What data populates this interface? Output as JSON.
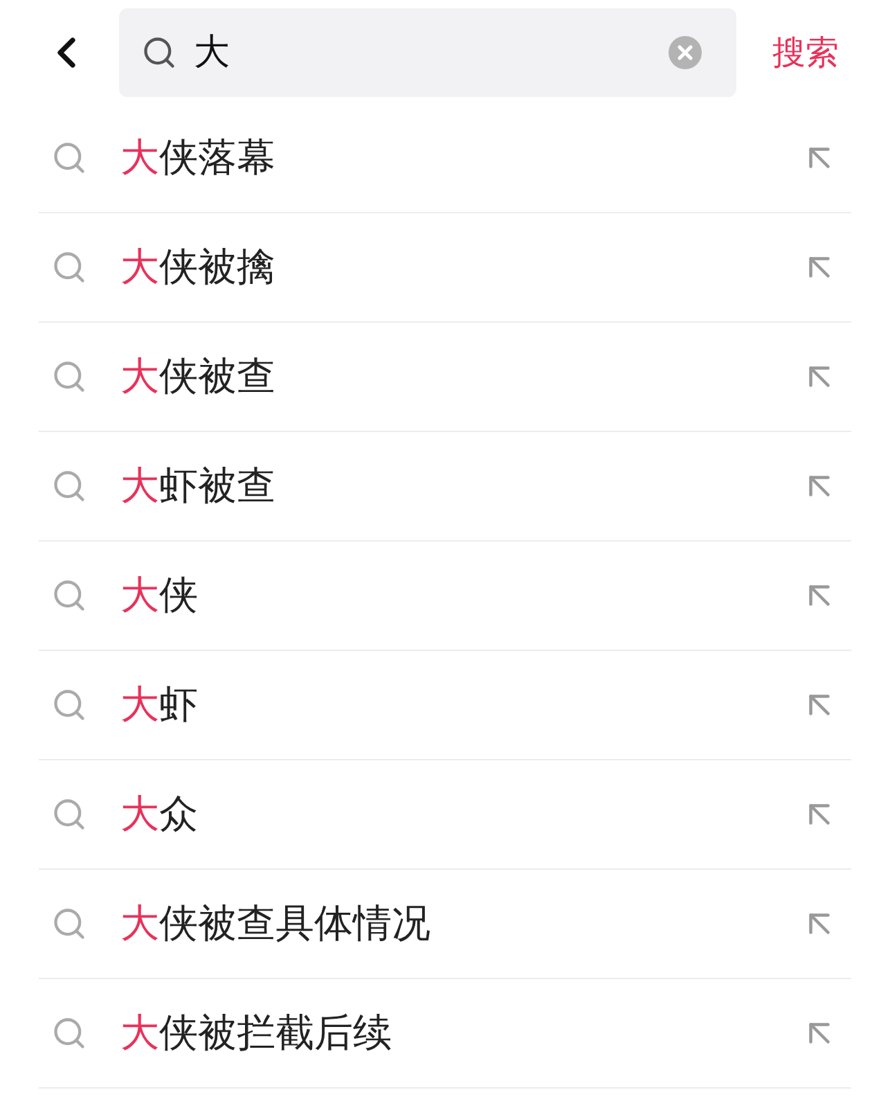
{
  "search": {
    "value": "大",
    "submit": "搜索"
  },
  "suggestions": [
    {
      "highlight": "大",
      "rest": "侠落幕"
    },
    {
      "highlight": "大",
      "rest": "侠被擒"
    },
    {
      "highlight": "大",
      "rest": "侠被查"
    },
    {
      "highlight": "大",
      "rest": "虾被查"
    },
    {
      "highlight": "大",
      "rest": "侠"
    },
    {
      "highlight": "大",
      "rest": "虾"
    },
    {
      "highlight": "大",
      "rest": "众"
    },
    {
      "highlight": "大",
      "rest": "侠被查具体情况"
    },
    {
      "highlight": "大",
      "rest": "侠被拦截后续"
    }
  ]
}
